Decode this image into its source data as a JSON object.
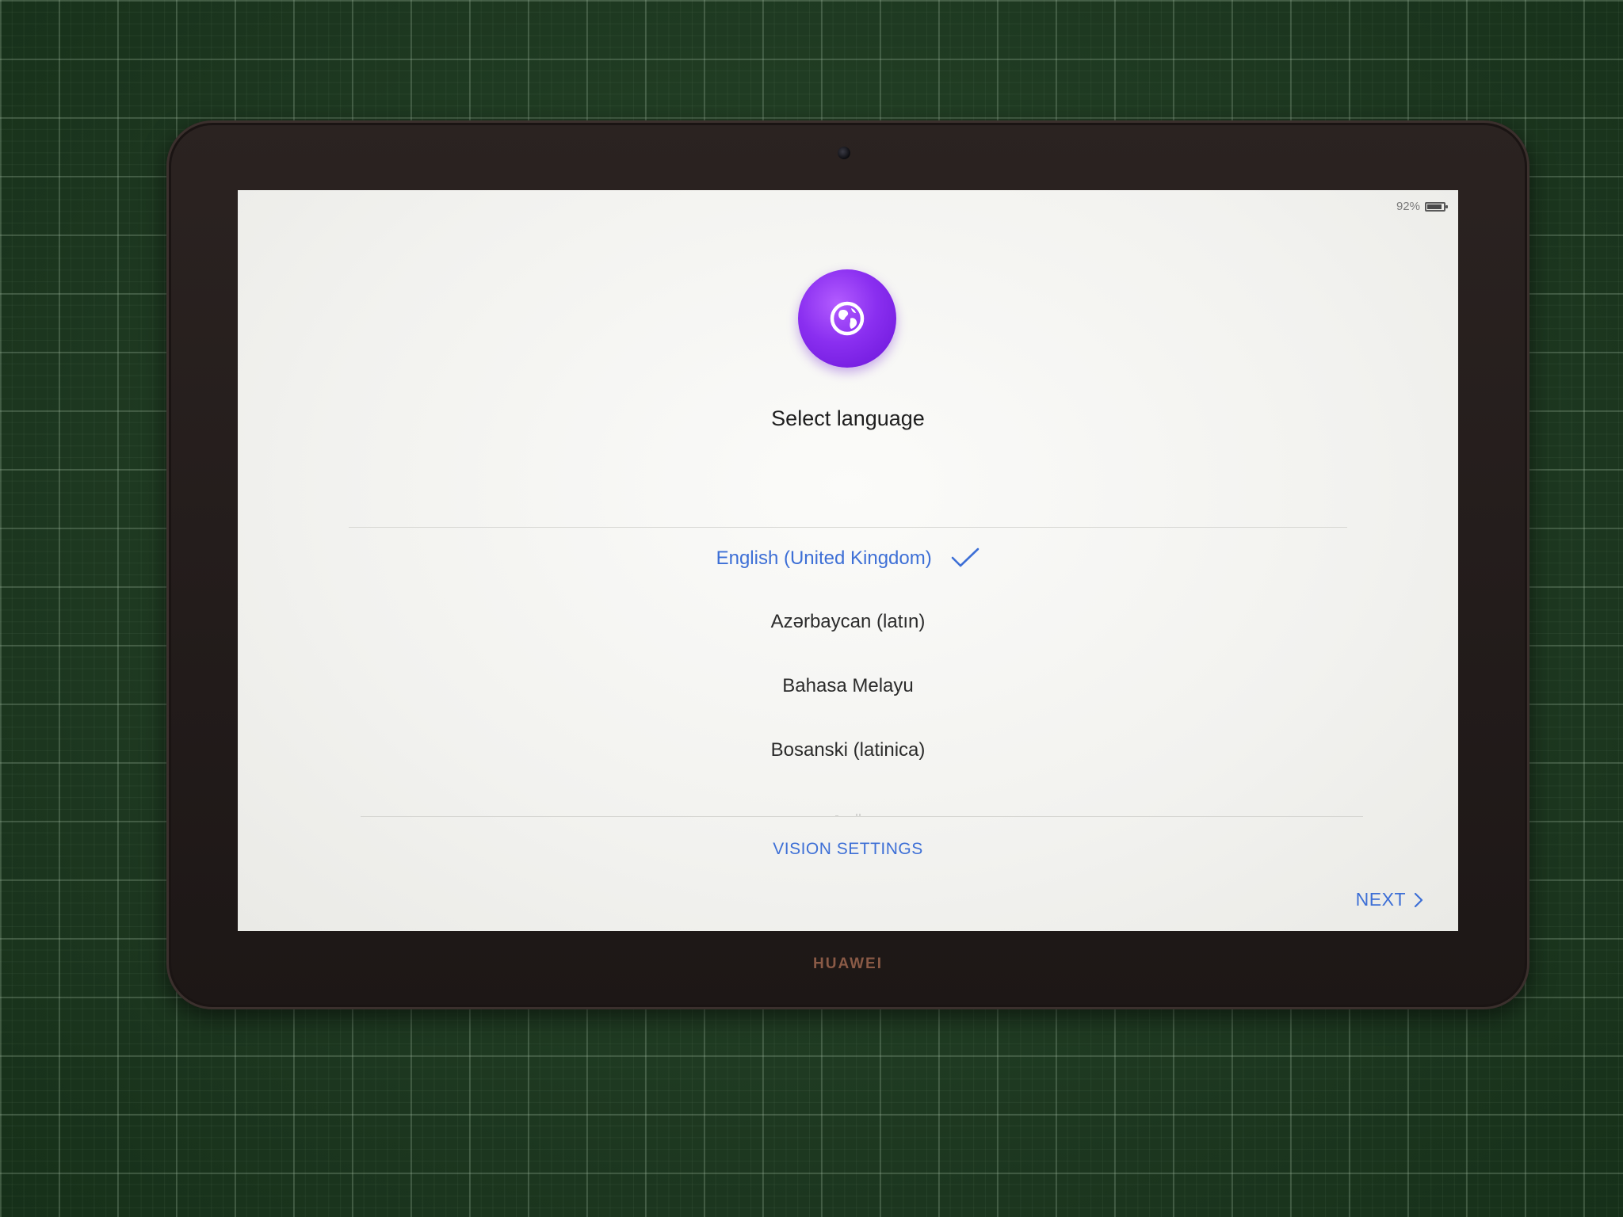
{
  "status_bar": {
    "battery_percent": "92%",
    "battery_level": 0.92,
    "icon": "battery-icon"
  },
  "header": {
    "icon": "globe-icon",
    "title": "Select language"
  },
  "languages": {
    "selected_index": 0,
    "items": [
      {
        "label": "English (United Kingdom)",
        "selected": true
      },
      {
        "label": "Azərbaycan (latın)",
        "selected": false
      },
      {
        "label": "Bahasa Melayu",
        "selected": false
      },
      {
        "label": "Bosanski (latinica)",
        "selected": false
      }
    ]
  },
  "footer": {
    "vision_settings_label": "VISION SETTINGS",
    "next_label": "NEXT"
  },
  "device": {
    "brand": "HUAWEI"
  },
  "colors": {
    "accent": "#3D6FD6",
    "badge_gradient_start": "#B35CFF",
    "badge_gradient_end": "#6A14D8",
    "screen_bg": "#F4F4F1",
    "mat": "#1F3D22"
  }
}
